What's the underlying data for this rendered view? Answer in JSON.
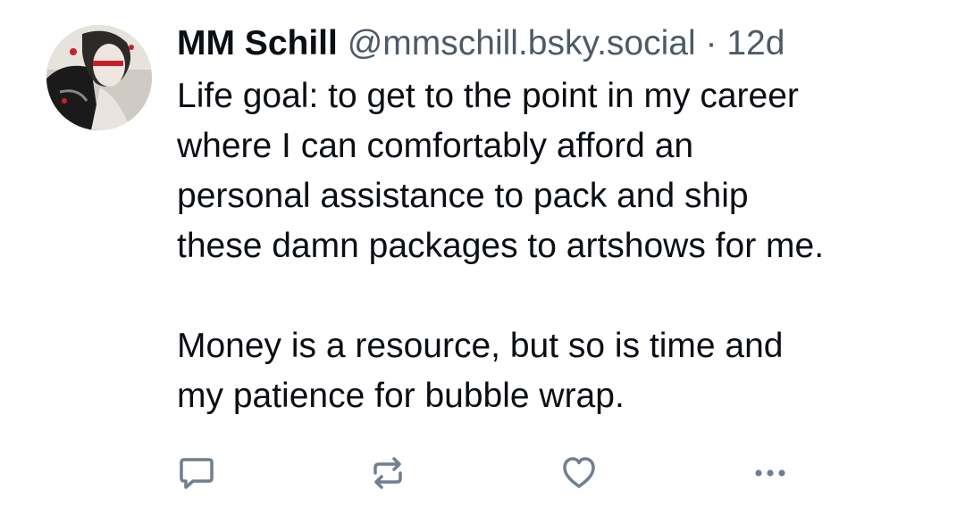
{
  "post": {
    "author_name": "MM Schill",
    "handle": "@mmschill.bsky.social",
    "separator": "·",
    "timestamp": "12d",
    "paragraphs": [
      {
        "lines": [
          "Life goal: to get to the point in my career",
          "where I can comfortably afford an",
          "personal assistance to pack and ship",
          "these damn packages to artshows for me."
        ]
      },
      {
        "lines": [
          "Money is a resource, but so is time and",
          "my patience for bubble wrap."
        ]
      }
    ]
  },
  "actions": [
    {
      "name": "reply",
      "icon": "reply-icon"
    },
    {
      "name": "repost",
      "icon": "repost-icon"
    },
    {
      "name": "like",
      "icon": "heart-icon"
    },
    {
      "name": "more",
      "icon": "more-dots-icon"
    }
  ],
  "colors": {
    "text": "#0b0f14",
    "muted": "#4e5a67",
    "icon": "#6f7f90",
    "accent_red": "#c8202a"
  }
}
